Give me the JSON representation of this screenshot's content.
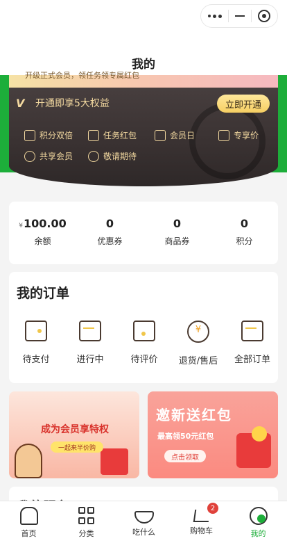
{
  "nav": {
    "title": "我的"
  },
  "member": {
    "strip_text": "开级正式会员，领任务领专属红包",
    "row_text": "开通即享5大权益",
    "open_button": "立即开通",
    "benefits": [
      "积分双倍",
      "任务红包",
      "会员日",
      "专享价",
      "共享会员",
      "敬请期待"
    ]
  },
  "stats": [
    {
      "prefix": "¥",
      "value": "100.00",
      "label": "余额"
    },
    {
      "prefix": "",
      "value": "0",
      "label": "优惠券"
    },
    {
      "prefix": "",
      "value": "0",
      "label": "商品券"
    },
    {
      "prefix": "",
      "value": "0",
      "label": "积分"
    }
  ],
  "orders": {
    "title": "我的订单",
    "items": [
      "待支付",
      "进行中",
      "待评价",
      "退货/售后",
      "全部订单"
    ]
  },
  "banners": {
    "left": {
      "headline": "成为会员享特权",
      "pill": "一起来半价购"
    },
    "right": {
      "headline": "邀新送红包",
      "sub": "最高领50元红包",
      "button": "点击领取"
    }
  },
  "services": {
    "title": "我的服务"
  },
  "tabbar": {
    "tabs": [
      "首页",
      "分类",
      "吃什么",
      "购物车",
      "我的"
    ],
    "cart_badge": "2",
    "active_color": "#1dae3a"
  }
}
